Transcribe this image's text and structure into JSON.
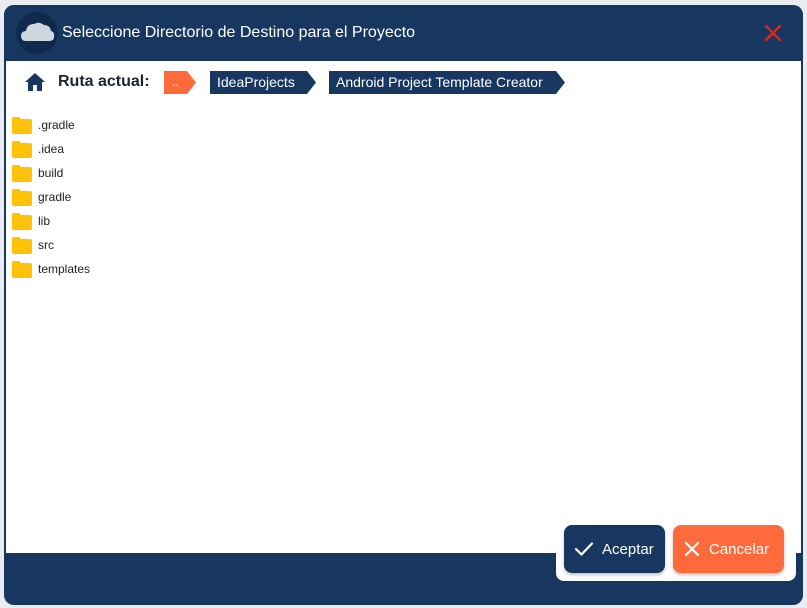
{
  "dialog": {
    "title": "Seleccione Directorio de Destino para el Proyecto",
    "logo_icon": "cloud-icon",
    "close_icon": "close-icon"
  },
  "pathbar": {
    "home_icon": "home-icon",
    "label": "Ruta actual:",
    "up_crumb": "..",
    "crumbs": [
      "IdeaProjects",
      "Android Project Template Creator"
    ]
  },
  "files": [
    {
      "name": ".gradle",
      "icon": "folder-icon"
    },
    {
      "name": ".idea",
      "icon": "folder-icon"
    },
    {
      "name": "build",
      "icon": "folder-icon"
    },
    {
      "name": "gradle",
      "icon": "folder-icon"
    },
    {
      "name": "lib",
      "icon": "folder-icon"
    },
    {
      "name": "src",
      "icon": "folder-icon"
    },
    {
      "name": "templates",
      "icon": "folder-icon"
    }
  ],
  "buttons": {
    "accept": {
      "label": "Aceptar",
      "icon": "check-icon"
    },
    "cancel": {
      "label": "Cancelar",
      "icon": "close-icon"
    }
  },
  "colors": {
    "primary": "#173761",
    "accent": "#ff6a3d",
    "close": "#e0261b",
    "folder": "#ffc107"
  }
}
